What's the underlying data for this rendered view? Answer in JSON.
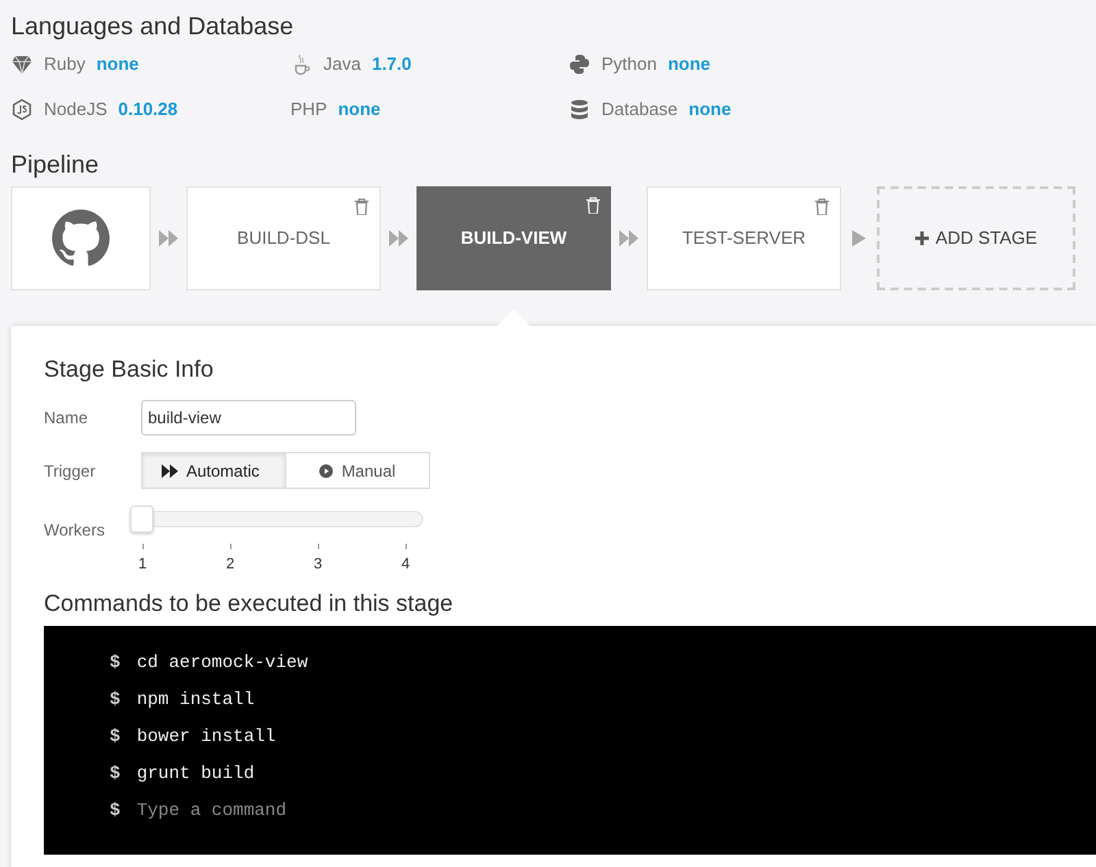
{
  "languages": {
    "title": "Languages and Database",
    "items": [
      {
        "kind": "ruby",
        "name": "Ruby",
        "value": "none"
      },
      {
        "kind": "java",
        "name": "Java",
        "value": "1.7.0"
      },
      {
        "kind": "python",
        "name": "Python",
        "value": "none"
      },
      {
        "kind": "node",
        "name": "NodeJS",
        "value": "0.10.28"
      },
      {
        "kind": "php",
        "name": "PHP",
        "value": "none"
      },
      {
        "kind": "database",
        "name": "Database",
        "value": "none"
      }
    ]
  },
  "pipeline": {
    "title": "Pipeline",
    "stages": [
      {
        "kind": "source"
      },
      {
        "kind": "stage",
        "label": "BUILD-DSL",
        "selected": false
      },
      {
        "kind": "stage",
        "label": "BUILD-VIEW",
        "selected": true
      },
      {
        "kind": "stage",
        "label": "TEST-SERVER",
        "selected": false
      },
      {
        "kind": "add",
        "label": "ADD STAGE"
      }
    ]
  },
  "stage_info": {
    "title": "Stage Basic Info",
    "name_label": "Name",
    "name_value": "build-view",
    "trigger_label": "Trigger",
    "triggers": [
      {
        "kind": "automatic",
        "label": "Automatic",
        "selected": true
      },
      {
        "kind": "manual",
        "label": "Manual",
        "selected": false
      }
    ],
    "workers_label": "Workers",
    "workers": {
      "level": 0,
      "ticks": [
        "1",
        "2",
        "3",
        "4"
      ]
    }
  },
  "commands": {
    "title": "Commands to be executed in this stage",
    "prompt": "$",
    "lines": [
      "cd aeromock-view",
      "npm install",
      "bower install",
      "grunt build"
    ],
    "placeholder": "Type a command"
  }
}
